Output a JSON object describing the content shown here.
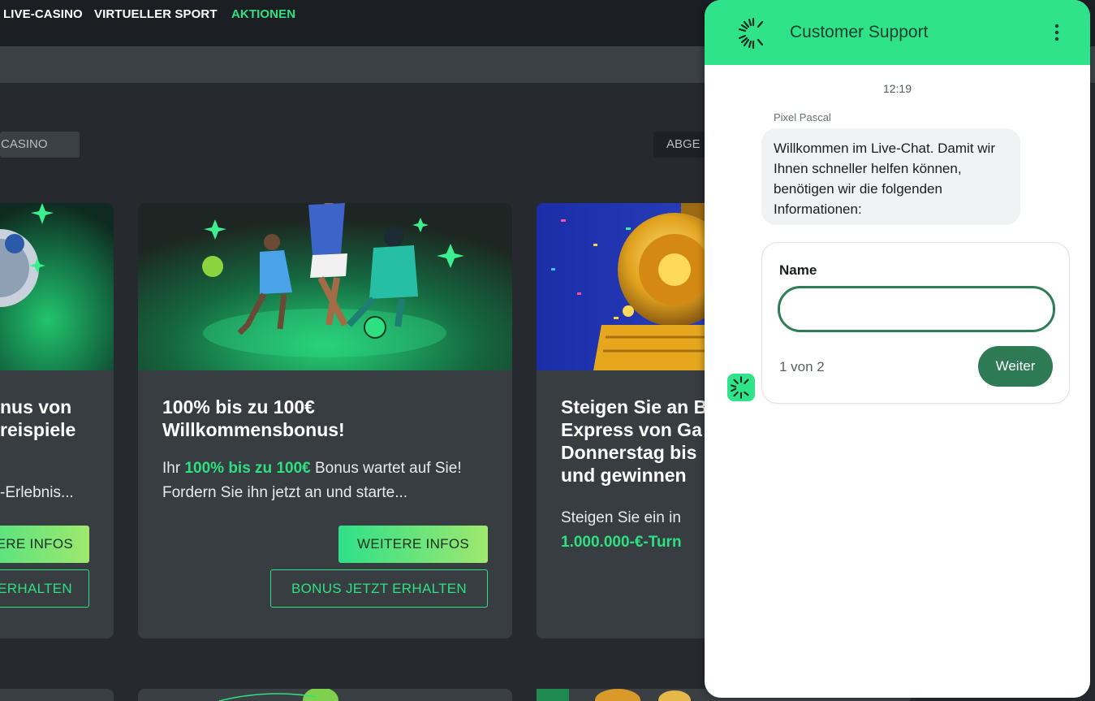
{
  "nav": {
    "items": [
      {
        "label": "LIVE-CASINO",
        "active": false
      },
      {
        "label": "VIRTUELLER SPORT",
        "active": false
      },
      {
        "label": "AKTIONEN",
        "active": true
      }
    ]
  },
  "filters": {
    "casino_label": "CASINO",
    "abge_label": "ABGE"
  },
  "cards": [
    {
      "title": "nus von\nreispiele",
      "text": "-Erlebnis...",
      "primary_label": "ERE INFOS",
      "secondary_label": "ERHALTEN"
    },
    {
      "title": "100% bis zu 100€\nWillkommensbonus!",
      "text_before": "Ihr ",
      "text_highlight": "100% bis zu 100€",
      "text_after": " Bonus wartet auf Sie! Fordern Sie ihn jetzt an und starte...",
      "primary_label": "WEITERE INFOS",
      "secondary_label": "BONUS JETZT ERHALTEN"
    },
    {
      "title": "Steigen Sie an B\nExpress von Ga\nDonnerstag bis\nund gewinnen",
      "text": "Steigen Sie ein in",
      "text_highlight": "1.000.000-€-Turn"
    }
  ],
  "chat": {
    "title": "Customer Support",
    "time": "12:19",
    "sender": "Pixel Pascal",
    "message": "Willkommen im Live-Chat. Damit wir Ihnen schneller helfen können, benötigen wir die folgenden Informationen:",
    "form": {
      "label": "Name",
      "value": "",
      "step": "1 von 2",
      "submit_label": "Weiter"
    }
  },
  "colors": {
    "accent": "#2ee080",
    "chat_header": "#2ee38a",
    "button_dark_green": "#2d7a55",
    "page_bg": "#262a2e",
    "card_bg": "#383d42"
  }
}
